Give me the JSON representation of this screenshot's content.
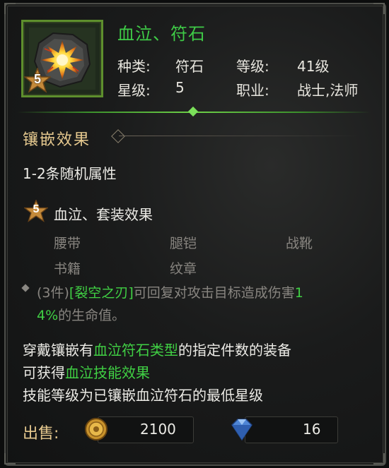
{
  "item": {
    "name": "血泣、符石",
    "star": "5",
    "type_label": "种类:",
    "type_value": "符石",
    "level_label": "等级:",
    "level_value": "41级",
    "grade_label": "星级:",
    "grade_value": "5",
    "class_label": "职业:",
    "class_value": "战士,法师"
  },
  "inlay": {
    "heading": "镶嵌效果",
    "random_attr": "1-2条随机属性",
    "set_star": "5",
    "set_title": "血泣、套装效果",
    "slots": [
      "腰带",
      "腿铠",
      "战靴",
      "书籍",
      "纹章"
    ],
    "set_bonus_prefix": "(3件)",
    "set_bonus_skill": "[裂空之刃]",
    "set_bonus_mid": "可回复对攻击目标造成伤害",
    "set_bonus_value_a": "1",
    "set_bonus_value_b": "4%",
    "set_bonus_suffix": "的生命值。"
  },
  "desc": {
    "line1_a": "穿戴镶嵌有",
    "line1_b": "血泣符石类型",
    "line1_c": "的指定件数的装备",
    "line2_a": "可获得",
    "line2_b": "血泣技能效果",
    "line3": "技能等级为已镶嵌血泣符石的最低星级"
  },
  "sale": {
    "label": "出售:",
    "gold": "2100",
    "diamond": "16"
  },
  "colors": {
    "title_green": "#3fcb47",
    "gold_text": "#e6c98f",
    "frame_green": "#5e8f2d"
  }
}
